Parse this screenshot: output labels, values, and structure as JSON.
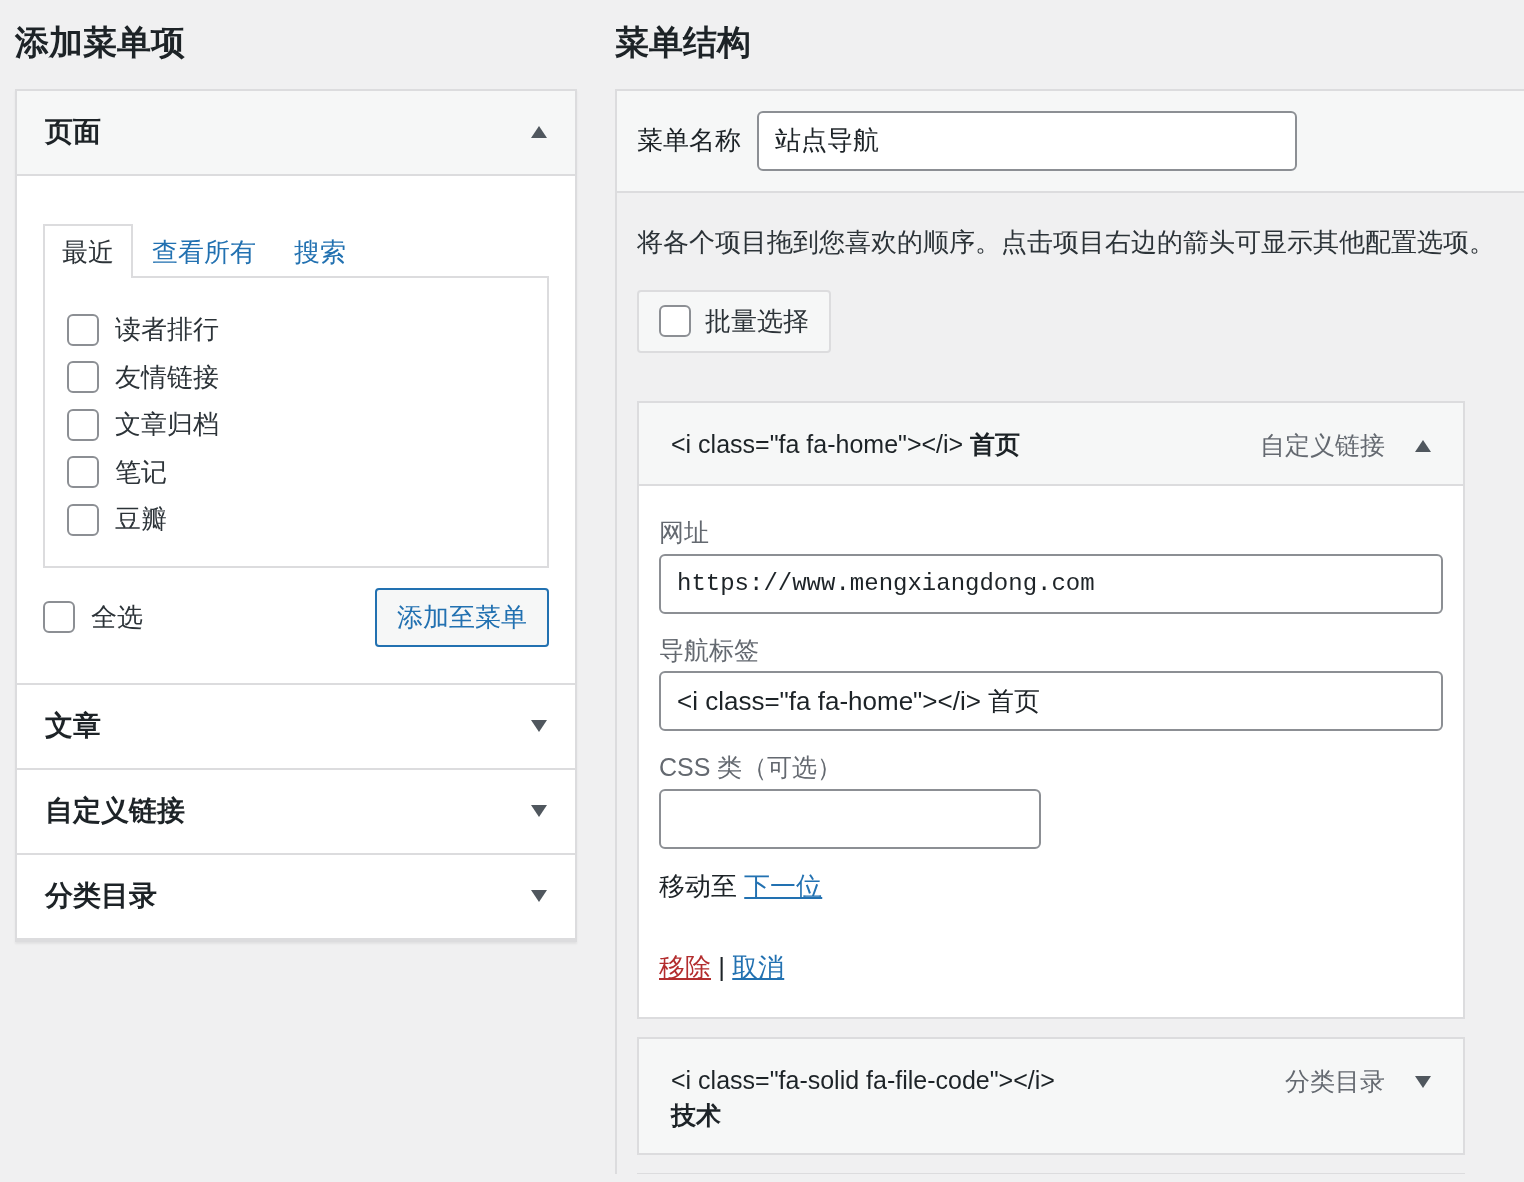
{
  "left": {
    "title": "添加菜单项",
    "sections": [
      {
        "title": "页面",
        "expanded": true,
        "tabs": [
          {
            "label": "最近",
            "selected": true
          },
          {
            "label": "查看所有",
            "selected": false
          },
          {
            "label": "搜索",
            "selected": false
          }
        ],
        "items": [
          {
            "label": "读者排行",
            "checked": false
          },
          {
            "label": "友情链接",
            "checked": false
          },
          {
            "label": "文章归档",
            "checked": false
          },
          {
            "label": "笔记",
            "checked": false
          },
          {
            "label": "豆瓣",
            "checked": false
          }
        ],
        "select_all": {
          "label": "全选",
          "checked": false
        },
        "add_button": "添加至菜单"
      },
      {
        "title": "文章",
        "expanded": false
      },
      {
        "title": "自定义链接",
        "expanded": false
      },
      {
        "title": "分类目录",
        "expanded": false
      }
    ]
  },
  "right": {
    "title": "菜单结构",
    "menu_name_label": "菜单名称",
    "menu_name_value": "站点导航",
    "instructions": "将各个项目拖到您喜欢的顺序。点击项目右边的箭头可显示其他配置选项。",
    "bulk_select": {
      "label": "批量选择",
      "checked": false
    },
    "items": [
      {
        "title": "<i class=\"fa fa-home\"></i> **首页**",
        "type": "自定义链接",
        "expanded": true,
        "fields": [
          {
            "label": "网址",
            "value": "https://www.mengxiangdong.com",
            "kind": "url"
          },
          {
            "label": "导航标签",
            "value": "<i class=\"fa fa-home\"></i> 首页",
            "kind": "text"
          },
          {
            "label": "CSS 类（可选）",
            "kind": "short"
          }
        ],
        "move_label": "移动至",
        "move_link": "下一位",
        "remove": "移除",
        "separator": "|",
        "cancel": "取消"
      },
      {
        "title": "<i class=\"fa-solid fa-file-code\"></i> **技术**",
        "type": "分类目录",
        "expanded": false
      }
    ]
  }
}
